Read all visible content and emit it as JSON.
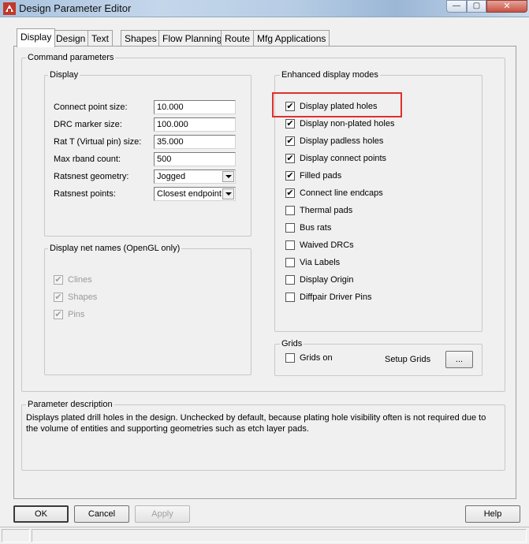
{
  "window": {
    "title": "Design Parameter Editor",
    "controls": {
      "minimize": "—",
      "maximize": "▢",
      "close": "✕"
    }
  },
  "tabs": [
    {
      "label": "Display",
      "active": true
    },
    {
      "label": "Design"
    },
    {
      "label": "Text"
    },
    {
      "label": "Shapes"
    },
    {
      "label": "Flow Planning"
    },
    {
      "label": "Route"
    },
    {
      "label": "Mfg Applications"
    }
  ],
  "command_parameters": {
    "title": "Command parameters",
    "display": {
      "title": "Display",
      "fields": [
        {
          "label": "Connect point size:",
          "value": "10.000"
        },
        {
          "label": "DRC marker size:",
          "value": "100.000"
        },
        {
          "label": "Rat T (Virtual pin) size:",
          "value": "35.000"
        },
        {
          "label": "Max rband count:",
          "value": "500"
        }
      ],
      "selects": [
        {
          "label": "Ratsnest geometry:",
          "value": "Jogged"
        },
        {
          "label": "Ratsnest points:",
          "value": "Closest endpoint"
        }
      ]
    },
    "net_names": {
      "title": "Display net names (OpenGL only)",
      "items": [
        {
          "label": "Clines",
          "checked": true
        },
        {
          "label": "Shapes",
          "checked": true
        },
        {
          "label": "Pins",
          "checked": true
        }
      ]
    },
    "enhanced": {
      "title": "Enhanced display modes",
      "items": [
        {
          "label": "Display plated holes",
          "checked": true
        },
        {
          "label": "Display non-plated holes",
          "checked": true
        },
        {
          "label": "Display padless holes",
          "checked": true
        },
        {
          "label": "Display connect points",
          "checked": true
        },
        {
          "label": "Filled pads",
          "checked": true
        },
        {
          "label": "Connect line endcaps",
          "checked": true
        },
        {
          "label": "Thermal pads",
          "checked": false
        },
        {
          "label": "Bus rats",
          "checked": false
        },
        {
          "label": "Waived DRCs",
          "checked": false
        },
        {
          "label": "Via Labels",
          "checked": false
        },
        {
          "label": "Display Origin",
          "checked": false
        },
        {
          "label": "Diffpair Driver Pins",
          "checked": false
        }
      ]
    },
    "grids": {
      "title": "Grids",
      "grids_on_label": "Grids on",
      "grids_on_checked": false,
      "setup_label": "Setup Grids",
      "setup_button": "..."
    }
  },
  "parameter_description": {
    "title": "Parameter description",
    "text": "Displays plated drill holes in the design. Unchecked by default, because plating hole visibility often is not required due to the volume of entities and supporting geometries such as etch layer pads."
  },
  "buttons": {
    "ok": "OK",
    "cancel": "Cancel",
    "apply": "Apply",
    "help": "Help"
  },
  "colors": {
    "highlight": "#e0302e"
  }
}
